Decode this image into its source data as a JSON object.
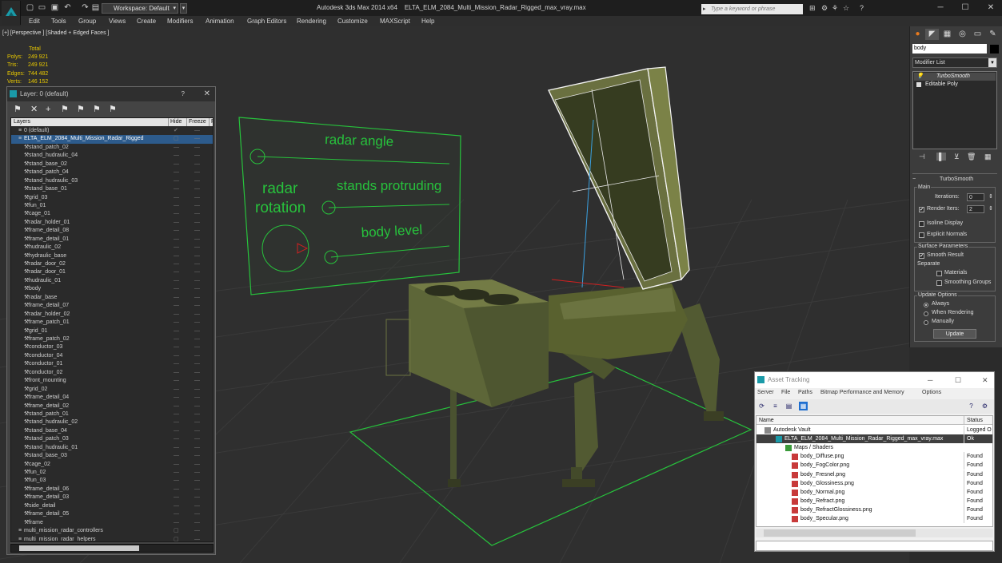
{
  "app": {
    "title": "Autodesk 3ds Max 2014 x64",
    "file": "ELTA_ELM_2084_Multi_Mission_Radar_Rigged_max_vray.max",
    "workspace": "Workspace: Default",
    "search_placeholder": "Type a keyword or phrase"
  },
  "menu": [
    "Edit",
    "Tools",
    "Group",
    "Views",
    "Create",
    "Modifiers",
    "Animation",
    "Graph Editors",
    "Rendering",
    "Customize",
    "MAXScript",
    "Help"
  ],
  "viewport": {
    "label": "[+] [Perspective ] [Shaded + Edged Faces ]",
    "stats": {
      "header": "Total",
      "rows": [
        {
          "label": "Polys:",
          "value": "249 921"
        },
        {
          "label": "Tris:",
          "value": "249 921"
        },
        {
          "label": "Edges:",
          "value": "744 482"
        },
        {
          "label": "Verts:",
          "value": "146 152"
        }
      ]
    },
    "controller_texts": {
      "radar_angle": "radar angle",
      "radar": "radar",
      "rotation": "rotation",
      "stands_protruding": "stands protruding",
      "body_level": "body level"
    },
    "accent_color": "#27c23c"
  },
  "layer_window": {
    "title": "Layer: 0 (default)",
    "help": "?",
    "columns": {
      "layers": "Layers",
      "hide": "Hide",
      "freeze": "Freeze",
      "r": "R"
    },
    "rows": [
      {
        "name": "0 (default)",
        "level": "top"
      },
      {
        "name": "ELTA_ELM_2084_Multi_Mission_Radar_Rigged",
        "level": "sel"
      },
      {
        "name": "stand_patch_02"
      },
      {
        "name": "stand_hudraulic_04"
      },
      {
        "name": "stand_base_02"
      },
      {
        "name": "stand_patch_04"
      },
      {
        "name": "stand_hudraulic_03"
      },
      {
        "name": "stand_base_01"
      },
      {
        "name": "grid_03"
      },
      {
        "name": "fun_01"
      },
      {
        "name": "cage_01"
      },
      {
        "name": "radar_holder_01"
      },
      {
        "name": "frame_detail_08"
      },
      {
        "name": "frame_detail_01"
      },
      {
        "name": "hudraulic_02"
      },
      {
        "name": "hydraulic_base"
      },
      {
        "name": "radar_door_02"
      },
      {
        "name": "radar_door_01"
      },
      {
        "name": "hudraulic_01"
      },
      {
        "name": "body"
      },
      {
        "name": "radar_base"
      },
      {
        "name": "frame_detail_07"
      },
      {
        "name": "radar_holder_02"
      },
      {
        "name": "frame_patch_01"
      },
      {
        "name": "grid_01"
      },
      {
        "name": "frame_patch_02"
      },
      {
        "name": "conductor_03"
      },
      {
        "name": "conductor_04"
      },
      {
        "name": "conductor_01"
      },
      {
        "name": "conductor_02"
      },
      {
        "name": "front_mounting"
      },
      {
        "name": "grid_02"
      },
      {
        "name": "frame_detail_04"
      },
      {
        "name": "frame_detail_02"
      },
      {
        "name": "stand_patch_01"
      },
      {
        "name": "stand_hudraulic_02"
      },
      {
        "name": "stand_base_04"
      },
      {
        "name": "stand_patch_03"
      },
      {
        "name": "stand_hudraulic_01"
      },
      {
        "name": "stand_base_03"
      },
      {
        "name": "cage_02"
      },
      {
        "name": "fun_02"
      },
      {
        "name": "fun_03"
      },
      {
        "name": "frame_detail_06"
      },
      {
        "name": "frame_detail_03"
      },
      {
        "name": "side_detail"
      },
      {
        "name": "frame_detail_05"
      },
      {
        "name": "frame"
      },
      {
        "name": "multi_mission_radar_controllers",
        "level": "top"
      },
      {
        "name": "multi_mission_radar_helpers",
        "level": "top"
      }
    ]
  },
  "command_panel": {
    "object_name": "body",
    "modifier_list": "Modifier List",
    "stack": [
      "TurboSmooth",
      "Editable Poly"
    ],
    "rollout": {
      "title": "TurboSmooth",
      "main": "Main",
      "iterations_label": "Iterations:",
      "iterations": "0",
      "render_iters_label": "Render Iters:",
      "render_iters": "2",
      "isoline": "Isoline Display",
      "explicit": "Explicit Normals",
      "surface": "Surface Parameters",
      "smooth_result": "Smooth Result",
      "separate": "Separate",
      "materials": "Materials",
      "smoothing_groups": "Smoothing Groups",
      "update_options": "Update Options",
      "always": "Always",
      "when_rendering": "When Rendering",
      "manually": "Manually",
      "update": "Update"
    }
  },
  "asset_tracking": {
    "title": "Asset Tracking",
    "menu": [
      "Server",
      "File",
      "Paths",
      "Bitmap Performance and Memory",
      "Options"
    ],
    "columns": {
      "name": "Name",
      "status": "Status"
    },
    "rows": [
      {
        "name": "Autodesk Vault",
        "status": "Logged O",
        "indent": 1
      },
      {
        "name": "ELTA_ELM_2084_Multi_Mission_Radar_Rigged_max_vray.max",
        "status": "Ok",
        "indent": 2,
        "dark": true
      },
      {
        "name": "Maps / Shaders",
        "status": "",
        "indent": 3
      },
      {
        "name": "body_Diffuse.png",
        "status": "Found",
        "indent": 4
      },
      {
        "name": "body_FogColor.png",
        "status": "Found",
        "indent": 4
      },
      {
        "name": "body_Fresnel.png",
        "status": "Found",
        "indent": 4
      },
      {
        "name": "body_Glossiness.png",
        "status": "Found",
        "indent": 4
      },
      {
        "name": "body_Normal.png",
        "status": "Found",
        "indent": 4
      },
      {
        "name": "body_Refract.png",
        "status": "Found",
        "indent": 4
      },
      {
        "name": "body_RefractGlossiness.png",
        "status": "Found",
        "indent": 4
      },
      {
        "name": "body_Specular.png",
        "status": "Found",
        "indent": 4
      }
    ]
  }
}
